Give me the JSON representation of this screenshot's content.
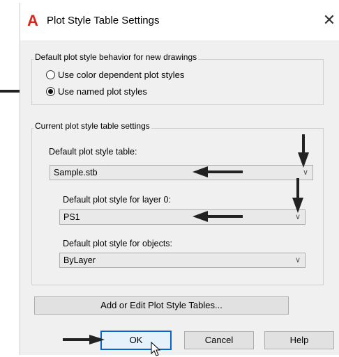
{
  "window": {
    "title": "Plot Style Table Settings",
    "logo_letter": "A",
    "close_glyph": "✕"
  },
  "behavior_group": {
    "legend": "Default plot style behavior for new drawings",
    "options": [
      {
        "label": "Use color dependent plot styles",
        "checked": false
      },
      {
        "label": "Use named plot styles",
        "checked": true
      }
    ]
  },
  "current_group": {
    "legend": "Current plot style table settings",
    "default_table_label": "Default plot style table:",
    "default_table_value": "Sample.stb",
    "layer0_label": "Default plot style for layer 0:",
    "layer0_value": "PS1",
    "objects_label": "Default plot style for objects:",
    "objects_value": "ByLayer"
  },
  "buttons": {
    "add_edit": "Add or Edit Plot Style Tables...",
    "ok": "OK",
    "cancel": "Cancel",
    "help": "Help"
  },
  "colors": {
    "logo": "#d8261c",
    "arrow": "#222222"
  },
  "icons": {
    "dropdown": "chevron-down-icon",
    "cursor": "mouse-pointer-icon"
  }
}
